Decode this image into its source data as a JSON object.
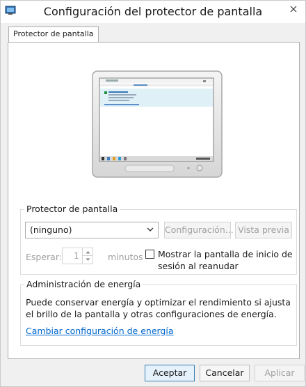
{
  "window": {
    "title": "Configuración del protector de pantalla"
  },
  "tabs": [
    {
      "label": "Protector de pantalla",
      "active": true
    }
  ],
  "screensaver": {
    "group_title": "Protector de pantalla",
    "selected": "(ninguno)",
    "settings_button": "Configuración...",
    "preview_button": "Vista previa",
    "wait_label": "Esperar:",
    "wait_value": "1",
    "minutes_label": "minutos",
    "resume_checkbox_label_line1": "Mostrar la pantalla de inicio de",
    "resume_checkbox_label_line2": "sesión al reanudar",
    "resume_checked": false
  },
  "power": {
    "group_title": "Administración de energía",
    "description_line1": "Puede conservar energía y optimizar el rendimiento si ajusta",
    "description_line2": "el brillo de la pantalla y otras configuraciones de energía.",
    "link": "Cambiar configuración de energía"
  },
  "footer": {
    "accept": "Aceptar",
    "cancel": "Cancelar",
    "apply": "Aplicar"
  },
  "colors": {
    "link": "#0066cc",
    "primary_border": "#3c7fb1",
    "disabled_text": "#a0a0a0"
  }
}
